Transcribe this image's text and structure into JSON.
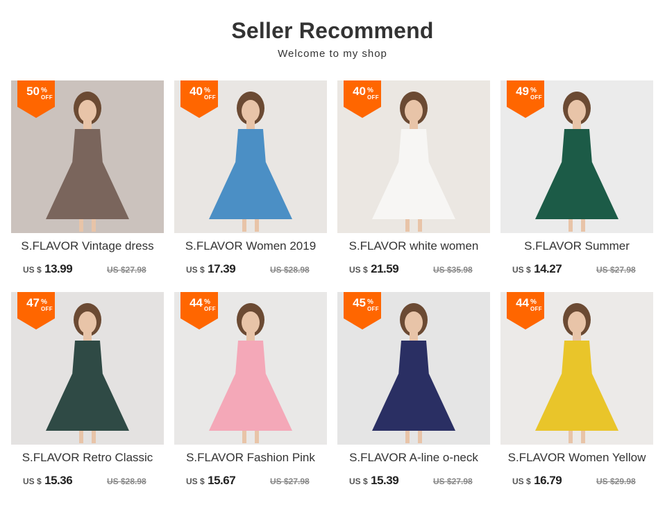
{
  "header": {
    "title": "Seller Recommend",
    "subtitle": "Welcome to my shop"
  },
  "colors": {
    "badge": "#ff6600",
    "title": "#333333",
    "old_price": "#888888"
  },
  "badge_labels": {
    "percent": "%",
    "off": "OFF"
  },
  "products": [
    {
      "discount": "50",
      "name": "S.FLAVOR Vintage dress",
      "currency": "US $",
      "price": "13.99",
      "old_price": "US $27.98",
      "dress_color": "#7a655c",
      "bg": "#cbc2bd"
    },
    {
      "discount": "40",
      "name": "S.FLAVOR Women 2019",
      "currency": "US $",
      "price": "17.39",
      "old_price": "US $28.98",
      "dress_color": "#4b8fc5",
      "bg": "#e9e6e3"
    },
    {
      "discount": "40",
      "name": "S.FLAVOR white women",
      "currency": "US $",
      "price": "21.59",
      "old_price": "US $35.98",
      "dress_color": "#f7f6f4",
      "bg": "#ebe7e2"
    },
    {
      "discount": "49",
      "name": "S.FLAVOR Summer",
      "currency": "US $",
      "price": "14.27",
      "old_price": "US $27.98",
      "dress_color": "#1c5b47",
      "bg": "#ebebeb"
    },
    {
      "discount": "47",
      "name": "S.FLAVOR Retro Classic",
      "currency": "US $",
      "price": "15.36",
      "old_price": "US $28.98",
      "dress_color": "#2f4a45",
      "bg": "#e4e2e1"
    },
    {
      "discount": "44",
      "name": "S.FLAVOR Fashion Pink",
      "currency": "US $",
      "price": "15.67",
      "old_price": "US $27.98",
      "dress_color": "#f4a8b8",
      "bg": "#e9e8e7"
    },
    {
      "discount": "45",
      "name": "S.FLAVOR A-line o-neck",
      "currency": "US $",
      "price": "15.39",
      "old_price": "US $27.98",
      "dress_color": "#2a2f63",
      "bg": "#e5e5e5"
    },
    {
      "discount": "44",
      "name": "S.FLAVOR Women Yellow",
      "currency": "US $",
      "price": "16.79",
      "old_price": "US $29.98",
      "dress_color": "#e9c52a",
      "bg": "#eceae8"
    }
  ]
}
